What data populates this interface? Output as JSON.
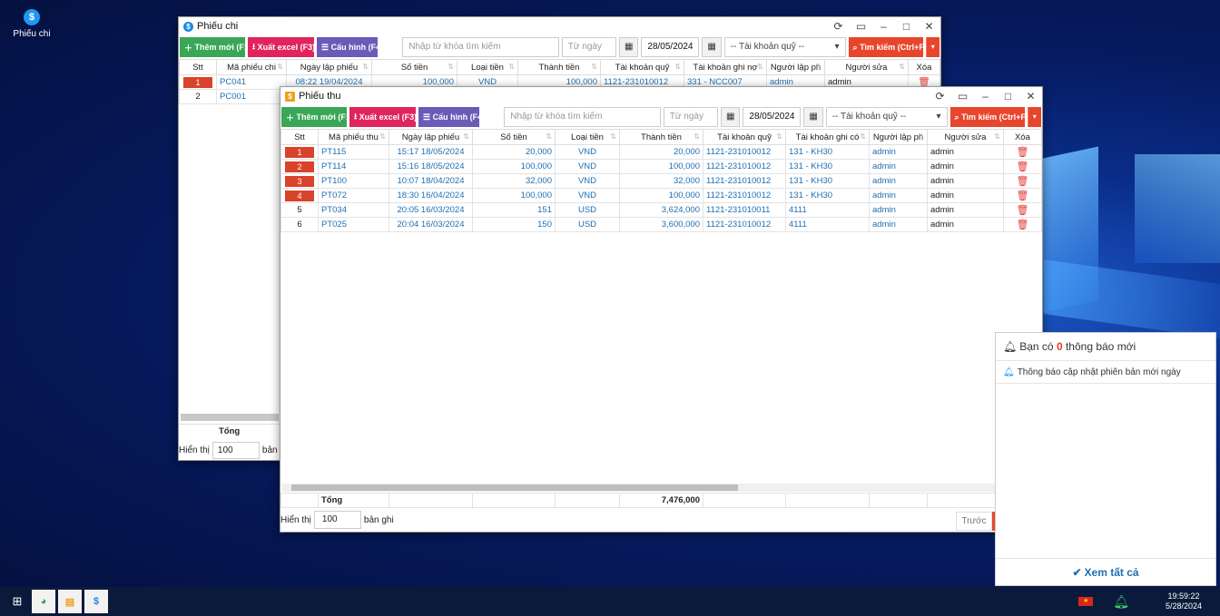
{
  "desktop": {
    "icon_label": "Phiếu chi",
    "icon_glyph": "$"
  },
  "toolbar_common": {
    "new_label": "Thêm mới (F1)",
    "excel_label": "Xuất excel (F3)",
    "config_label": "Cấu hình (F4)",
    "keyword_placeholder": "Nhập từ khóa tìm kiếm",
    "from_date_placeholder": "Từ ngày",
    "to_date": "28/05/2024",
    "account_select": "-- Tài khoản quỹ --",
    "search_label": "Tìm kiếm (Ctrl+F)"
  },
  "chi_window": {
    "title": "Phiếu chi",
    "columns": [
      "Stt",
      "Mã phiếu chi",
      "Ngày lập phiếu",
      "Số tiền",
      "Loại tiền",
      "Thành tiền",
      "Tài khoản quỹ",
      "Tài khoản ghi nợ",
      "Người lập ph",
      "Người sửa",
      "Xóa"
    ],
    "rows": [
      {
        "stt": "1",
        "code": "PC041",
        "date": "08:22 19/04/2024",
        "amount": "100,000",
        "currency": "VND",
        "total": "100,000",
        "fund": "1121-231010012",
        "debit": "331 - NCC007",
        "creator": "admin",
        "editor": "admin"
      },
      {
        "stt": "2",
        "code": "PC001"
      }
    ],
    "total_label": "Tổng",
    "show_label": "Hiển thị",
    "page_size": "100",
    "records_label": "bản g"
  },
  "thu_window": {
    "title": "Phiếu thu",
    "columns": [
      "Stt",
      "Mã phiếu thu",
      "Ngày lập phiếu",
      "Số tiền",
      "Loại tiền",
      "Thành tiền",
      "Tài khoản quỹ",
      "Tài khoản ghi có",
      "Người lập ph",
      "Người sửa",
      "Xóa"
    ],
    "rows": [
      {
        "stt": "1",
        "code": "PT115",
        "date": "15:17 18/05/2024",
        "amount": "20,000",
        "currency": "VND",
        "total": "20,000",
        "fund": "1121-231010012",
        "credit": "131 - KH30",
        "creator": "admin",
        "editor": "admin",
        "highlight": true
      },
      {
        "stt": "2",
        "code": "PT114",
        "date": "15:16 18/05/2024",
        "amount": "100,000",
        "currency": "VND",
        "total": "100,000",
        "fund": "1121-231010012",
        "credit": "131 - KH30",
        "creator": "admin",
        "editor": "admin",
        "highlight": true
      },
      {
        "stt": "3",
        "code": "PT100",
        "date": "10:07 18/04/2024",
        "amount": "32,000",
        "currency": "VND",
        "total": "32,000",
        "fund": "1121-231010012",
        "credit": "131 - KH30",
        "creator": "admin",
        "editor": "admin",
        "highlight": true
      },
      {
        "stt": "4",
        "code": "PT072",
        "date": "18:30 16/04/2024",
        "amount": "100,000",
        "currency": "VND",
        "total": "100,000",
        "fund": "1121-231010012",
        "credit": "131 - KH30",
        "creator": "admin",
        "editor": "admin",
        "highlight": true
      },
      {
        "stt": "5",
        "code": "PT034",
        "date": "20:05 16/03/2024",
        "amount": "151",
        "currency": "USD",
        "total": "3,624,000",
        "fund": "1121-231010011",
        "credit": "4111",
        "creator": "admin",
        "editor": "admin",
        "highlight": false
      },
      {
        "stt": "6",
        "code": "PT025",
        "date": "20:04 16/03/2024",
        "amount": "150",
        "currency": "USD",
        "total": "3,600,000",
        "fund": "1121-231010012",
        "credit": "4111",
        "creator": "admin",
        "editor": "admin",
        "highlight": false
      }
    ],
    "total_label": "Tổng",
    "grand_total": "7,476,000",
    "show_label": "Hiển thị",
    "page_size": "100",
    "records_label": "bản ghi",
    "prev_label": "Trước"
  },
  "notification": {
    "prefix": "Bạn có",
    "count": "0",
    "suffix": "thông báo mới",
    "item": "Thông báo cập nhật phiên bản mới ngày",
    "view_all": "Xem tất cả"
  },
  "taskbar": {
    "time": "19:59:22",
    "date": "5/28/2024"
  },
  "colors": {
    "accent_red": "#d9432b",
    "green": "#3aa757",
    "pink": "#e0245e",
    "purple": "#6a5bb8",
    "search": "#e8462c",
    "link": "#1f6fb2"
  }
}
